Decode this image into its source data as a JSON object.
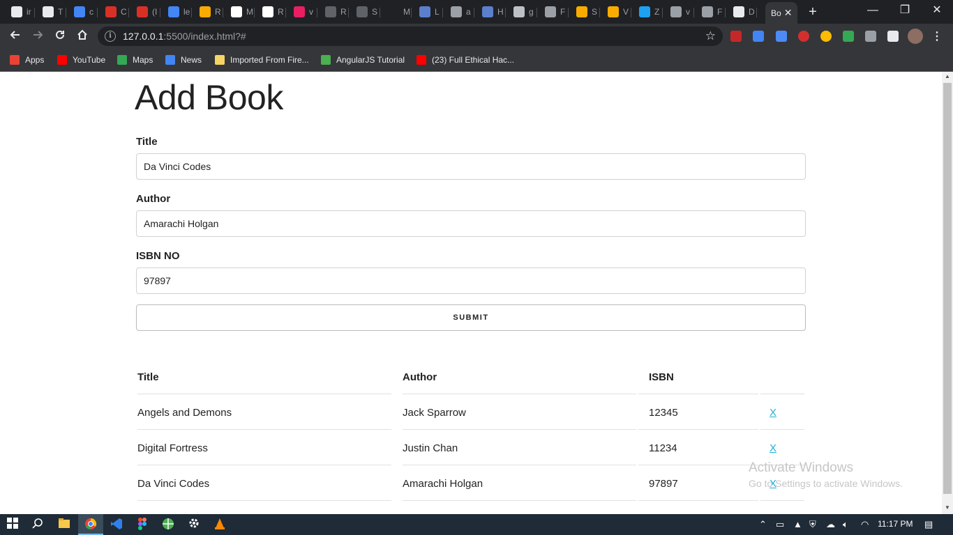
{
  "browser": {
    "tabs": [
      {
        "label": "ir",
        "color": "#e8eaed"
      },
      {
        "label": "T",
        "color": "#e8eaed"
      },
      {
        "label": "c",
        "color": "#4285f4"
      },
      {
        "label": "C",
        "color": "#d93025"
      },
      {
        "label": "(I",
        "color": "#d93025"
      },
      {
        "label": "le",
        "color": "#4285f4"
      },
      {
        "label": "R",
        "color": "#f9ab00"
      },
      {
        "label": "M",
        "color": "#ffffff"
      },
      {
        "label": "R",
        "color": "#ffffff"
      },
      {
        "label": "v",
        "color": "#e91e63"
      },
      {
        "label": "R",
        "color": "#5f6368"
      },
      {
        "label": "S",
        "color": "#5f6368"
      },
      {
        "label": "M",
        "color": "#202124"
      },
      {
        "label": "L",
        "color": "#5b7fcc"
      },
      {
        "label": "a",
        "color": "#9aa0a6"
      },
      {
        "label": "H",
        "color": "#5b7fcc"
      },
      {
        "label": "g",
        "color": "#bdc1c6"
      },
      {
        "label": "F",
        "color": "#9aa0a6"
      },
      {
        "label": "S",
        "color": "#f9ab00"
      },
      {
        "label": "V",
        "color": "#f9ab00"
      },
      {
        "label": "Z",
        "color": "#1da1f2"
      },
      {
        "label": "v",
        "color": "#9aa0a6"
      },
      {
        "label": "F",
        "color": "#9aa0a6"
      },
      {
        "label": "D",
        "color": "#e8eaed"
      }
    ],
    "active_tab": {
      "label": "Bo",
      "close": "✕"
    },
    "new_tab": "+",
    "window_controls": {
      "minimize": "—",
      "restore": "❐",
      "close": "✕"
    },
    "url_host": "127.0.0.1",
    "url_path": ":5500/index.html?#",
    "info_icon": "i",
    "star_icon": "☆",
    "menu_icon": "⋮",
    "bookmarks": [
      {
        "label": "Apps",
        "icon": "apps-grid-icon",
        "color": "#ea4335"
      },
      {
        "label": "YouTube",
        "icon": "youtube-icon",
        "color": "#ff0000"
      },
      {
        "label": "Maps",
        "icon": "maps-icon",
        "color": "#34a853"
      },
      {
        "label": "News",
        "icon": "news-icon",
        "color": "#4285f4"
      },
      {
        "label": "Imported From Fire...",
        "icon": "folder-icon",
        "color": "#f6d365"
      },
      {
        "label": "AngularJS Tutorial",
        "icon": "w3-icon",
        "color": "#4caf50"
      },
      {
        "label": "(23) Full Ethical Hac...",
        "icon": "youtube-icon",
        "color": "#ff0000"
      }
    ],
    "extension_colors": [
      "#c62828",
      "#4285f4",
      "#4c8bf5",
      "#d32f2f",
      "#fbbc04",
      "#34a853",
      "#9aa0a6",
      "#e8eaed"
    ]
  },
  "page": {
    "heading": "Add Book",
    "form": {
      "title_label": "Title",
      "title_value": "Da Vinci Codes",
      "author_label": "Author",
      "author_value": "Amarachi Holgan",
      "isbn_label": "ISBN NO",
      "isbn_value": "97897",
      "submit_label": "SUBMIT"
    },
    "table": {
      "headers": [
        "Title",
        "Author",
        "ISBN"
      ],
      "rows": [
        {
          "title": "Angels and Demons",
          "author": "Jack Sparrow",
          "isbn": "12345",
          "delete": "X"
        },
        {
          "title": "Digital Fortress",
          "author": "Justin Chan",
          "isbn": "11234",
          "delete": "X"
        },
        {
          "title": "Da Vinci Codes",
          "author": "Amarachi Holgan",
          "isbn": "97897",
          "delete": "X"
        }
      ]
    },
    "link_color": "#1eaedb"
  },
  "watermark": {
    "line1": "Activate Windows",
    "line2": "Go to Settings to activate Windows."
  },
  "taskbar": {
    "clock": "11:17 PM",
    "icons": [
      "windows-start-icon",
      "search-icon",
      "file-explorer-icon",
      "chrome-icon",
      "vscode-icon",
      "figma-icon",
      "app-icon",
      "settings-icon",
      "vlc-icon"
    ]
  }
}
